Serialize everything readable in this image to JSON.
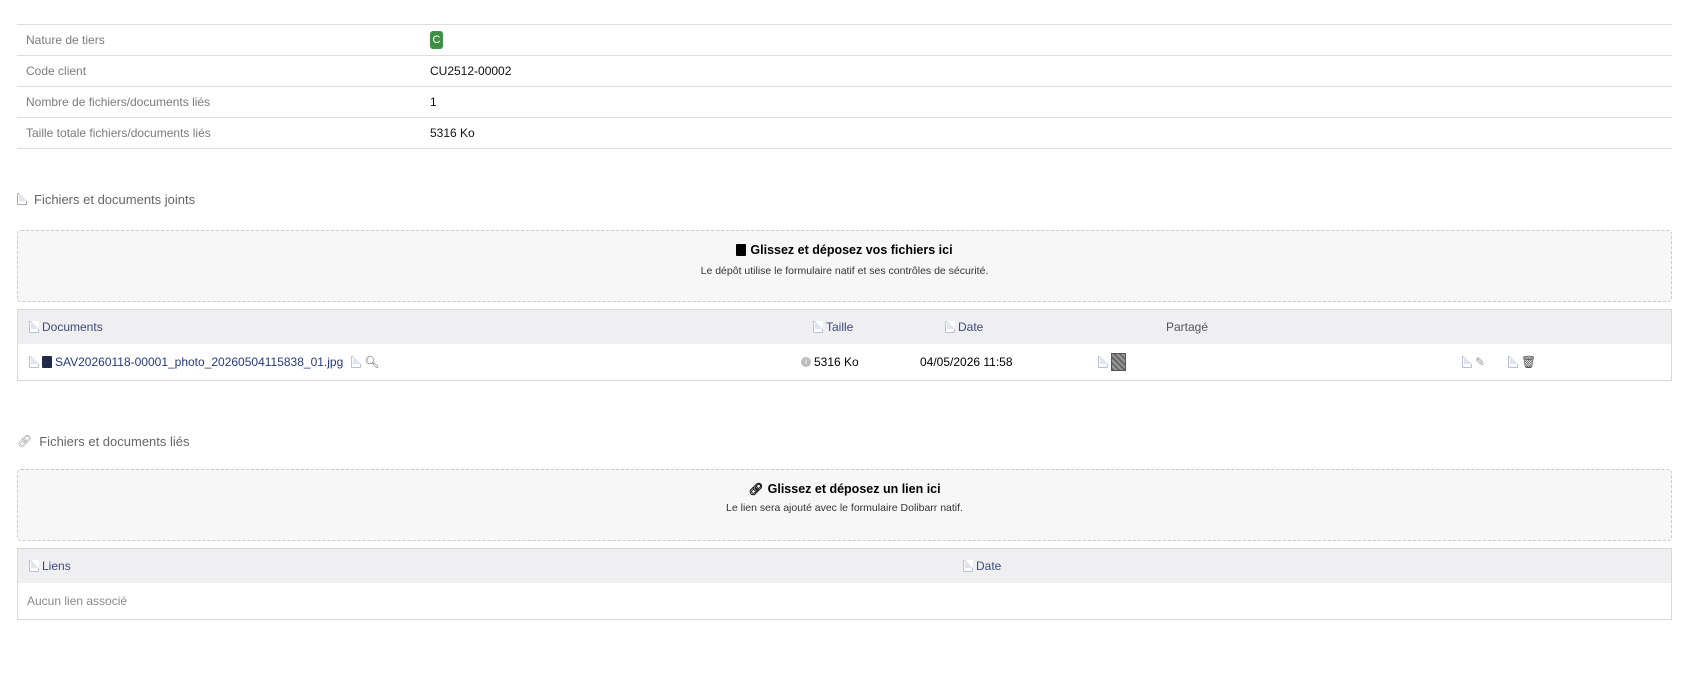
{
  "summary": {
    "rows": [
      {
        "label": "Nature de tiers",
        "value": "C"
      },
      {
        "label": "Code client",
        "value": "CU2512-00002"
      },
      {
        "label": "Nombre de fichiers/documents liés",
        "value": "1"
      },
      {
        "label": "Taille totale fichiers/documents liés",
        "value": "5316 Ko"
      }
    ],
    "badge_color": "#3f8f46"
  },
  "attached": {
    "title": "Fichiers et documents joints",
    "drop_title": "Glissez et déposez vos fichiers ici",
    "drop_subtitle": "Le dépôt utilise le formulaire natif et ses contrôles de sécurité.",
    "columns": {
      "documents": "Documents",
      "size": "Taille",
      "date": "Date",
      "share": "Partagé"
    },
    "rows": [
      {
        "filename": "SAV20260118-00001_photo_20260504115838_01.jpg",
        "size": "5316 Ko",
        "date": "04/05/2026 11:58"
      }
    ]
  },
  "linked": {
    "title": "Fichiers et documents liés",
    "drop_title": "Glissez et déposez un lien ici",
    "drop_subtitle": "Le lien sera ajouté avec le formulaire Dolibarr natif.",
    "columns": {
      "links": "Liens",
      "date": "Date"
    },
    "empty": "Aucun lien associé"
  },
  "colors": {
    "header_link": "#3c4a7a",
    "file_link": "#253a7a"
  }
}
